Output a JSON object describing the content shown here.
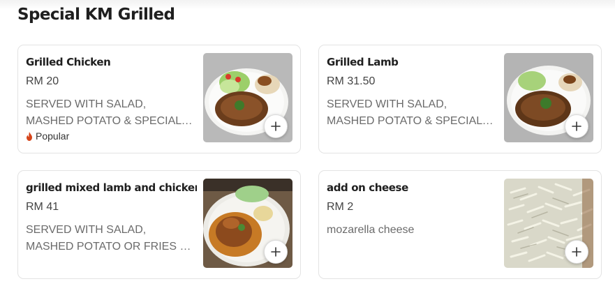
{
  "section": {
    "title": "Special KM Grilled"
  },
  "items": [
    {
      "name": "Grilled Chicken",
      "price": "RM 20",
      "description": "SERVED WITH SALAD, MASHED POTATO & SPECIAL GRAVY",
      "badge": "Popular",
      "image_icon": "grilled-chicken-plate",
      "add_icon": "plus-icon"
    },
    {
      "name": "Grilled Lamb",
      "price": "RM 31.50",
      "description": "SERVED WITH SALAD, MASHED POTATO & SPECIAL GRAVY",
      "image_icon": "grilled-lamb-plate",
      "add_icon": "plus-icon"
    },
    {
      "name": "grilled mixed lamb and chicken",
      "price": "RM 41",
      "description": "SERVED WITH SALAD, MASHED POTATO OR FRIES & SPECIAL...",
      "image_icon": "grilled-mixed-plate",
      "add_icon": "plus-icon"
    },
    {
      "name": "add on cheese",
      "price": "RM 2",
      "description": "mozarella cheese",
      "image_icon": "shredded-cheese",
      "add_icon": "plus-icon"
    }
  ],
  "colors": {
    "badge_fire": "#d6451b",
    "text_primary": "#1f1f1f",
    "text_secondary": "#6b6b6b",
    "card_border": "#e3e3e3"
  }
}
